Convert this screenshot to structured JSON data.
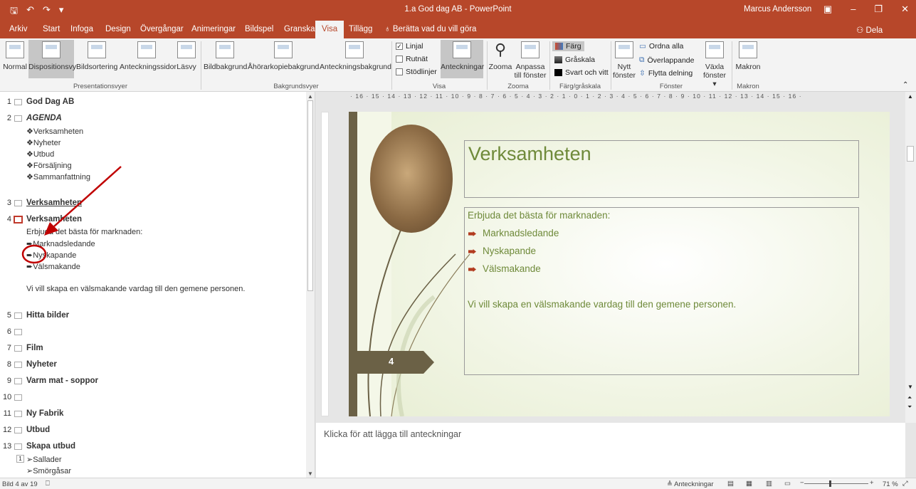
{
  "titlebar": {
    "title": "1.a God dag AB - PowerPoint",
    "user": "Marcus Andersson",
    "qa_icons": [
      "save-icon",
      "undo-icon",
      "redo-icon",
      "customize-icon"
    ]
  },
  "menu": {
    "tabs": [
      "Arkiv",
      "Start",
      "Infoga",
      "Design",
      "Övergångar",
      "Animeringar",
      "Bildspel",
      "Granska",
      "Visa",
      "Tillägg"
    ],
    "tellme": "Berätta vad du vill göra",
    "share": "Dela"
  },
  "ribbon": {
    "presentationsvyer": {
      "label": "Presentationsvyer",
      "buttons": [
        "Normal",
        "Dispositionsvy",
        "Bildsortering",
        "Anteckningssidor",
        "Läsvy"
      ]
    },
    "bakgrundsvyer": {
      "label": "Bakgrundsvyer",
      "buttons": [
        "Bildbakgrund",
        "Åhörarkopiebakgrund",
        "Anteckningsbakgrund"
      ]
    },
    "visa": {
      "label": "Visa",
      "checks": [
        {
          "label": "Linjal",
          "checked": true
        },
        {
          "label": "Rutnät",
          "checked": false
        },
        {
          "label": "Stödlinjer",
          "checked": false
        }
      ],
      "notes": "Anteckningar"
    },
    "zooma": {
      "label": "Zooma",
      "zoom": "Zooma",
      "fit1": "Anpassa",
      "fit2": "till fönster"
    },
    "farg": {
      "label": "Färg/gråskala",
      "items": [
        "Färg",
        "Gråskala",
        "Svart och vitt"
      ]
    },
    "fonster": {
      "label": "Fönster",
      "new1": "Nytt",
      "new2": "fönster",
      "items": [
        "Ordna alla",
        "Överlappande",
        "Flytta delning"
      ],
      "switch1": "Växla",
      "switch2": "fönster"
    },
    "makron": {
      "label": "Makron",
      "btn": "Makron"
    }
  },
  "outline": {
    "slides": [
      {
        "num": "1",
        "title": "God Dag AB"
      },
      {
        "num": "2",
        "title": "AGENDA",
        "bullets": [
          "❖Verksamheten",
          "❖Nyheter",
          "❖Utbud",
          "❖Försäljning",
          "❖Sammanfattning"
        ]
      },
      {
        "num": "3",
        "title": "Verksamheten"
      },
      {
        "num": "4",
        "title": "Verksamheten",
        "body": "Erbjuda det bästa för marknaden:",
        "bullets": [
          "Marknadsledande",
          "Nyskapande",
          "Välsmakande"
        ],
        "extra": "Vi vill skapa en välsmakande vardag till den gemene personen."
      },
      {
        "num": "5",
        "title": "Hitta bilder"
      },
      {
        "num": "6",
        "title": ""
      },
      {
        "num": "7",
        "title": "Film"
      },
      {
        "num": "8",
        "title": "Nyheter"
      },
      {
        "num": "9",
        "title": "Varm mat - soppor"
      },
      {
        "num": "10",
        "title": ""
      },
      {
        "num": "11",
        "title": "Ny Fabrik"
      },
      {
        "num": "12",
        "title": "Utbud"
      },
      {
        "num": "13",
        "title": "Skapa utbud",
        "sub_level": "1",
        "bullets": [
          "➢Sallader",
          "➢Smörgåsar"
        ]
      }
    ]
  },
  "ruler": {
    "ticks": "· 16 · 15 · 14 · 13 · 12 · 11 · 10 · 9 · 8 · 7 · 6 · 5 · 4 · 3 · 2 · 1 · 0 · 1 · 2 · 3 · 4 · 5 · 6 · 7 · 8 · 9 · 10 · 11 · 12 · 13 · 14 · 15 · 16 ·"
  },
  "slide": {
    "title": "Verksamheten",
    "body": "Erbjuda det bästa för marknaden:",
    "bullets": [
      "Marknadsledande",
      "Nyskapande",
      "Välsmakande"
    ],
    "extra": "Vi vill skapa en välsmakande vardag till den gemene personen.",
    "number": "4"
  },
  "notes": {
    "placeholder": "Klicka för att lägga till anteckningar"
  },
  "status": {
    "slide": "Bild 4 av 19",
    "notes": "Anteckningar",
    "zoom": "71 %"
  },
  "colors": {
    "accent": "#b7472a",
    "slide_text": "#6f8a3a",
    "annotation": "#c00000"
  }
}
